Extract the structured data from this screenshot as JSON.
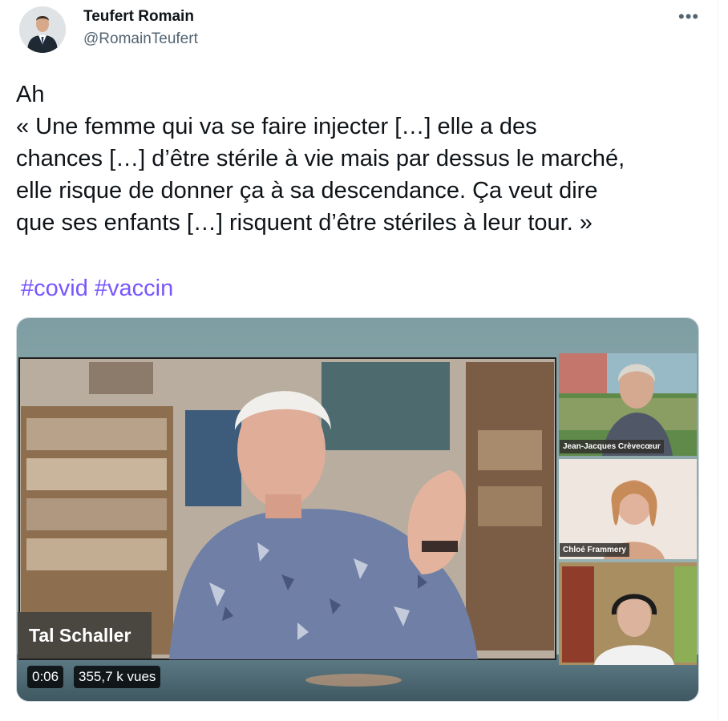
{
  "author": {
    "name": "Teufert Romain",
    "handle": "@RomainTeufert"
  },
  "tweet": {
    "lines": [
      "Ah",
      "« Une femme qui va se faire injecter […] elle a des",
      "chances […] d’être stérile à vie mais par dessus le marché,",
      "elle risque de donner ça à sa descendance. Ça veut dire",
      "que ses enfants […] risquent d’être stériles à leur tour. »"
    ],
    "hashtags": [
      "#covid",
      "#vaccin"
    ]
  },
  "video": {
    "speaker_label": "Tal Schaller",
    "participants": [
      "Jean-Jacques Crèvecœur",
      "Chloé Frammery",
      ""
    ],
    "timestamp": "0:06",
    "views": "355,7 k vues"
  },
  "icons": {
    "more": "more-dots-icon"
  },
  "colors": {
    "hashtag": "#7856ff",
    "handle": "#536471"
  }
}
